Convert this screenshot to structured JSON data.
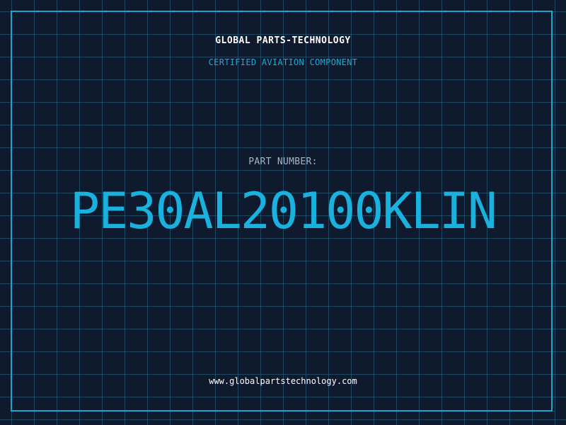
{
  "header": {
    "company": "GLOBAL PARTS-TECHNOLOGY",
    "tagline": "CERTIFIED AVIATION COMPONENT"
  },
  "part": {
    "label": "PART NUMBER:",
    "number": "PE30AL20100KLIN"
  },
  "footer": {
    "website": "www.globalpartstechnology.com"
  },
  "colors": {
    "background": "#101a2e",
    "grid": "#266e8c",
    "accent": "#19b2df",
    "frame": "#1aa6cf",
    "text_primary": "#ffffff",
    "text_muted": "#a9b4c4"
  }
}
